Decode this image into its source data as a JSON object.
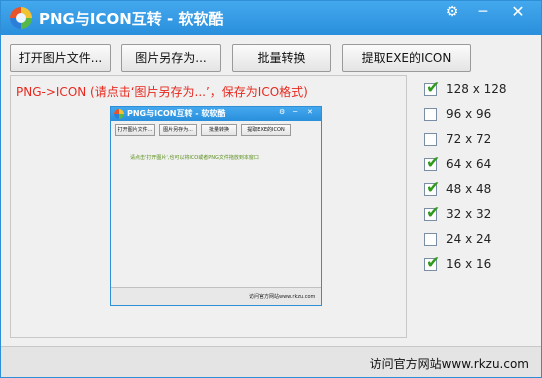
{
  "window": {
    "title": "PNG与ICON互转 - 软软酷",
    "gear_glyph": "⚙",
    "minimize_glyph": "─",
    "close_glyph": "✕"
  },
  "toolbar": {
    "open_label": "打开图片文件...",
    "save_as_label": "图片另存为...",
    "batch_label": "批量转换",
    "extract_label": "提取EXE的ICON"
  },
  "preview": {
    "hint": "PNG->ICON (请点击‘图片另存为...’，保存为ICO格式)",
    "mini_window": {
      "title": "PNG与ICON互转 - 软软酷",
      "buttons": [
        "打开图片文件...",
        "图片另存为...",
        "批量转换",
        "提取EXE的ICON"
      ],
      "message": "请点击'打开图片',也可以将ICO或者PNG文件拖放到本窗口",
      "footer": "访问官方网站www.rkzu.com"
    }
  },
  "sizes": [
    {
      "label": "128 x 128",
      "checked": true
    },
    {
      "label": "96 x 96",
      "checked": false
    },
    {
      "label": "72 x 72",
      "checked": false
    },
    {
      "label": "64 x 64",
      "checked": true
    },
    {
      "label": "48 x 48",
      "checked": true
    },
    {
      "label": "32 x 32",
      "checked": true
    },
    {
      "label": "24 x 24",
      "checked": false
    },
    {
      "label": "16 x 16",
      "checked": true
    }
  ],
  "footer": {
    "link": "访问官方网站www.rkzu.com"
  },
  "colors": {
    "titlebar": "#2a8fdc",
    "hint_text": "#e8281e",
    "checkmark": "#2f9a1c"
  }
}
